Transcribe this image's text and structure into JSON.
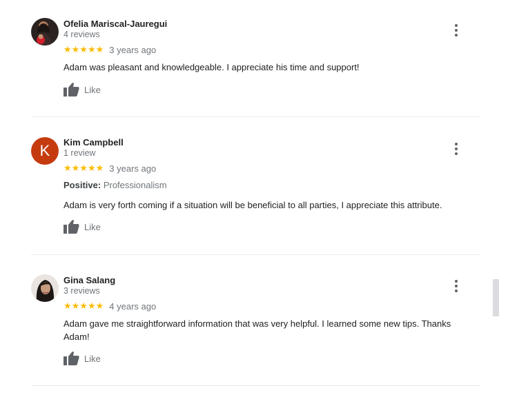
{
  "reviews": [
    {
      "name": "Ofelia Mariscal-Jauregui",
      "count": "4 reviews",
      "stars": "★★★★★",
      "date": "3 years ago",
      "text": "Adam was pleasant and knowledgeable. I appreciate his time and support!",
      "like_label": "Like"
    },
    {
      "avatar_letter": "K",
      "name": "Kim Campbell",
      "count": "1 review",
      "stars": "★★★★★",
      "date": "3 years ago",
      "attr_label": "Positive:",
      "attr_value": "Professionalism",
      "text": "Adam is very forth coming if a situation will be beneficial to all parties, I appreciate this attribute.",
      "like_label": "Like"
    },
    {
      "name": "Gina Salang",
      "count": "3 reviews",
      "stars": "★★★★★",
      "date": "4 years ago",
      "text": "Adam gave me straightforward information that was very helpful. I learned some new tips. Thanks Adam!",
      "like_label": "Like"
    }
  ],
  "colors": {
    "star": "#fbbc04",
    "avatar_k": "#c53b0f",
    "secondary_text": "#70757a",
    "divider": "#e8eaed"
  },
  "icons": [
    "thumbs-up-icon",
    "more-vert-icon",
    "star-icon"
  ]
}
